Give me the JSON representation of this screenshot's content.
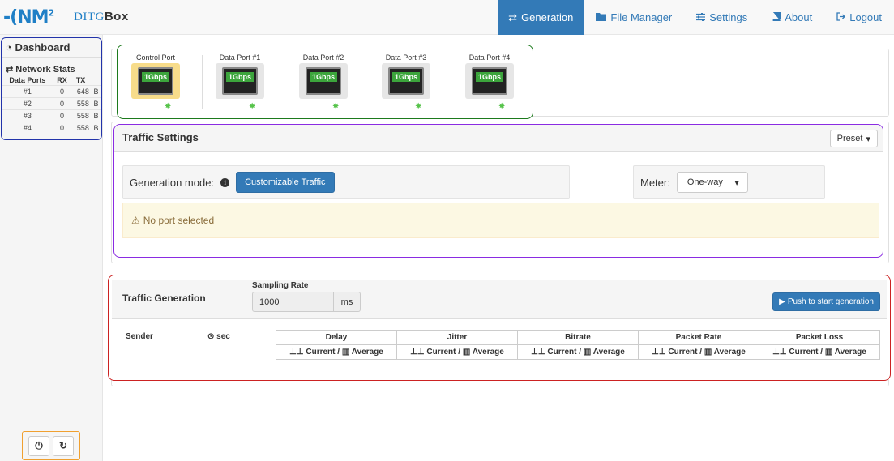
{
  "brand": {
    "logo": "NM",
    "logo_sup": "2",
    "app_prefix": "DITG",
    "app_suffix": "Box"
  },
  "nav": [
    {
      "label": "Generation",
      "icon": "exchange-icon",
      "active": true
    },
    {
      "label": "File Manager",
      "icon": "folder-icon"
    },
    {
      "label": "Settings",
      "icon": "sliders-icon"
    },
    {
      "label": "About",
      "icon": "book-icon"
    },
    {
      "label": "Logout",
      "icon": "logout-icon"
    }
  ],
  "sidebar": {
    "dashboard_title": "Dashboard",
    "net_stats_title": "Network Stats",
    "columns": [
      "Data Ports",
      "RX",
      "TX"
    ],
    "rows": [
      {
        "port": "#1",
        "rx": "0",
        "tx": "648",
        "unit": "B"
      },
      {
        "port": "#2",
        "rx": "0",
        "tx": "558",
        "unit": "B"
      },
      {
        "port": "#3",
        "rx": "0",
        "tx": "558",
        "unit": "B"
      },
      {
        "port": "#4",
        "rx": "0",
        "tx": "558",
        "unit": "B"
      }
    ]
  },
  "ports": [
    {
      "label": "Control Port",
      "speed": "1Gbps",
      "selected": true
    },
    {
      "label": "Data Port #1",
      "speed": "1Gbps"
    },
    {
      "label": "Data Port #2",
      "speed": "1Gbps"
    },
    {
      "label": "Data Port #3",
      "speed": "1Gbps"
    },
    {
      "label": "Data Port #4",
      "speed": "1Gbps"
    }
  ],
  "traffic_settings": {
    "title": "Traffic Settings",
    "preset_label": "Preset",
    "gen_mode_label": "Generation mode:",
    "gen_mode_button": "Customizable Traffic",
    "meter_label": "Meter:",
    "meter_value": "One-way",
    "alert": "No port selected"
  },
  "traffic_generation": {
    "title": "Traffic Generation",
    "sampling_label": "Sampling Rate",
    "sampling_value": "1000",
    "sampling_unit": "ms",
    "push_button": "Push to start generation",
    "sender_label": "Sender",
    "timer_label": "sec",
    "metric_headers": [
      "Delay",
      "Jitter",
      "Bitrate",
      "Packet Rate",
      "Packet Loss"
    ],
    "metric_sub_current": "Current",
    "metric_sub_average": "Average"
  },
  "colors": {
    "accent": "#337ab7",
    "port_selected": "#f7dc8a",
    "speed_badge": "#3ca53c",
    "alert_bg": "#fcf8e3"
  }
}
